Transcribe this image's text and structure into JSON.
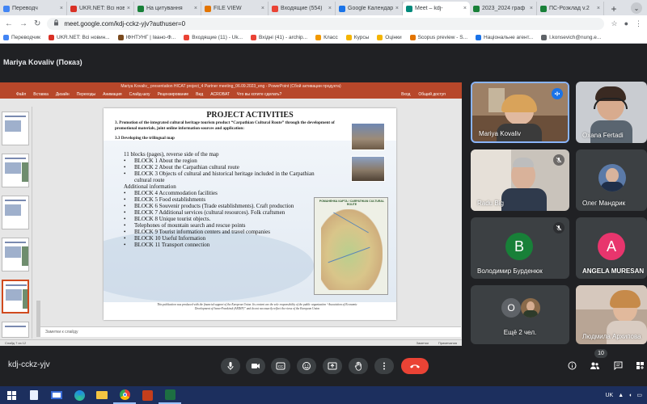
{
  "browser": {
    "tabs": [
      {
        "label": "Переводч",
        "color": "#4285f4",
        "active": false
      },
      {
        "label": "UKR.NET: Всі нов",
        "color": "#d93025",
        "active": false
      },
      {
        "label": "На цитування",
        "color": "#188038",
        "active": false
      },
      {
        "label": "FILE VIEW",
        "color": "#e37400",
        "active": false
      },
      {
        "label": "Входящие (554)",
        "color": "#ea4335",
        "active": false
      },
      {
        "label": "Google Календар",
        "color": "#1a73e8",
        "active": false
      },
      {
        "label": "Meet – kdj-",
        "color": "#00897b",
        "active": true
      },
      {
        "label": "2023_2024 граф",
        "color": "#188038",
        "active": false
      },
      {
        "label": "ПС-Розклад v.2",
        "color": "#188038",
        "active": false
      }
    ],
    "new_tab_symbol": "+",
    "tab_menu_symbol": "⌄",
    "url": "meet.google.com/kdj-cckz-yjv?authuser=0",
    "bookmarks": [
      {
        "label": "Переводчик",
        "color": "#4285f4"
      },
      {
        "label": "UKR.NET: Всі новин...",
        "color": "#d93025"
      },
      {
        "label": "ІФНТУНГ | Івано-Ф...",
        "color": "#7a4a1e"
      },
      {
        "label": "Входящие (11) - Uk...",
        "color": "#ea4335"
      },
      {
        "label": "Вхідні (41) - archip...",
        "color": "#ea4335"
      },
      {
        "label": "Класс",
        "color": "#f29900"
      },
      {
        "label": "Курсы",
        "color": "#f4b400"
      },
      {
        "label": "Оцінки",
        "color": "#f4b400"
      },
      {
        "label": "Scopus preview - S...",
        "color": "#e37400"
      },
      {
        "label": "Національне агент...",
        "color": "#1a73e8"
      },
      {
        "label": "l.konsevich@nung.e...",
        "color": "#5f6368"
      }
    ]
  },
  "meet": {
    "presenter_label": "Mariya Kovaliv (Показ)",
    "meeting_code": "kdj-cckz-yjv",
    "people_count": "10",
    "participants": [
      {
        "name": "Mariya Kovaliv",
        "type": "video"
      },
      {
        "name": "Oxana Fertadi",
        "type": "video"
      },
      {
        "name": "Radu Big",
        "type": "video"
      },
      {
        "name": "Олег Мандрик",
        "type": "video"
      },
      {
        "name": "Володимир Бурденюк",
        "type": "avatar",
        "initial": "В",
        "color": "#188038"
      },
      {
        "name": "ANGELA MURESAN",
        "type": "avatar",
        "initial": "A",
        "color": "#e8356d"
      },
      {
        "name": "Ещё 2 чел.",
        "type": "more",
        "initial": "O"
      },
      {
        "name": "Людмила Архипова",
        "type": "video"
      }
    ]
  },
  "powerpoint": {
    "title": "Mariya Kovaliv_ presentation HICAT project_4 Partner meeting_06.09.2023_eng - PowerPoint (Сбой активации продукта)",
    "menu": [
      "Файл",
      "Вставка",
      "Дизайн",
      "Переходы",
      "Анимация",
      "Слайд-шоу",
      "Рецензирование",
      "Вид",
      "ACROBAT",
      "Что вы хотите сделать?"
    ],
    "menu_right": [
      "Вход",
      "Общий доступ"
    ],
    "notes_placeholder": "Заметки к слайду",
    "status_left": "Слайд 7 из 12",
    "status_right": [
      "Заметки",
      "Примечания"
    ],
    "slide": {
      "title": "PROJECT ACTIVITIES",
      "heading": "3. Promotion of the integrated cultural heritage tourism product “Carpathian Cultural Route” through the development of promotional materials, joint online information sources and application:",
      "subheading": "3.3 Developing the trilingual map",
      "lines": [
        {
          "text": "11 blocks (pages), reverse side of the map",
          "bullet": false
        },
        {
          "text": "BLOCK 1 About the region",
          "bullet": true
        },
        {
          "text": "BLOCK 2 About the Carpathian cultural route",
          "bullet": true
        },
        {
          "text": "BLOCK 3 Objects of cultural and historical heritage included in the Carpathian",
          "bullet": true
        },
        {
          "text": "cultural route",
          "bullet": false,
          "indent": true
        },
        {
          "text": "Additional information",
          "bullet": false
        },
        {
          "text": "BLOCK 4 Accommodation facilities",
          "bullet": true
        },
        {
          "text": "BLOCK 5 Food establishments",
          "bullet": true
        },
        {
          "text": "BLOCK 6 Souvenir products (Trade establishments). Craft production",
          "bullet": true
        },
        {
          "text": "BLOCK 7 Additional services (cultural resources). Folk craftsmen",
          "bullet": true
        },
        {
          "text": "BLOCK 8 Unique tourist objects.",
          "bullet": true
        },
        {
          "text": "Telephones of mountain search and rescue points",
          "bullet": true
        },
        {
          "text": "BLOCK 9 Tourist information centers and travel companies",
          "bullet": true
        },
        {
          "text": "BLOCK 10 Useful Information",
          "bullet": true
        },
        {
          "text": "BLOCK 11 Transport connection",
          "bullet": true
        }
      ],
      "bullet_char": "•",
      "footer": "This publication was produced with the financial support of the European Union. Its content are the sole responsibility of the public organization “Association of Economic Development of Ivano-Frankivsk (AEDIF)” and do not necessarily reflect the views of the European Union",
      "map_title": "РОМАНЕНКА КАРТА / CARPATHIAN CULTURAL ROUTE"
    }
  },
  "taskbar": {
    "tray_lang": "UK"
  }
}
